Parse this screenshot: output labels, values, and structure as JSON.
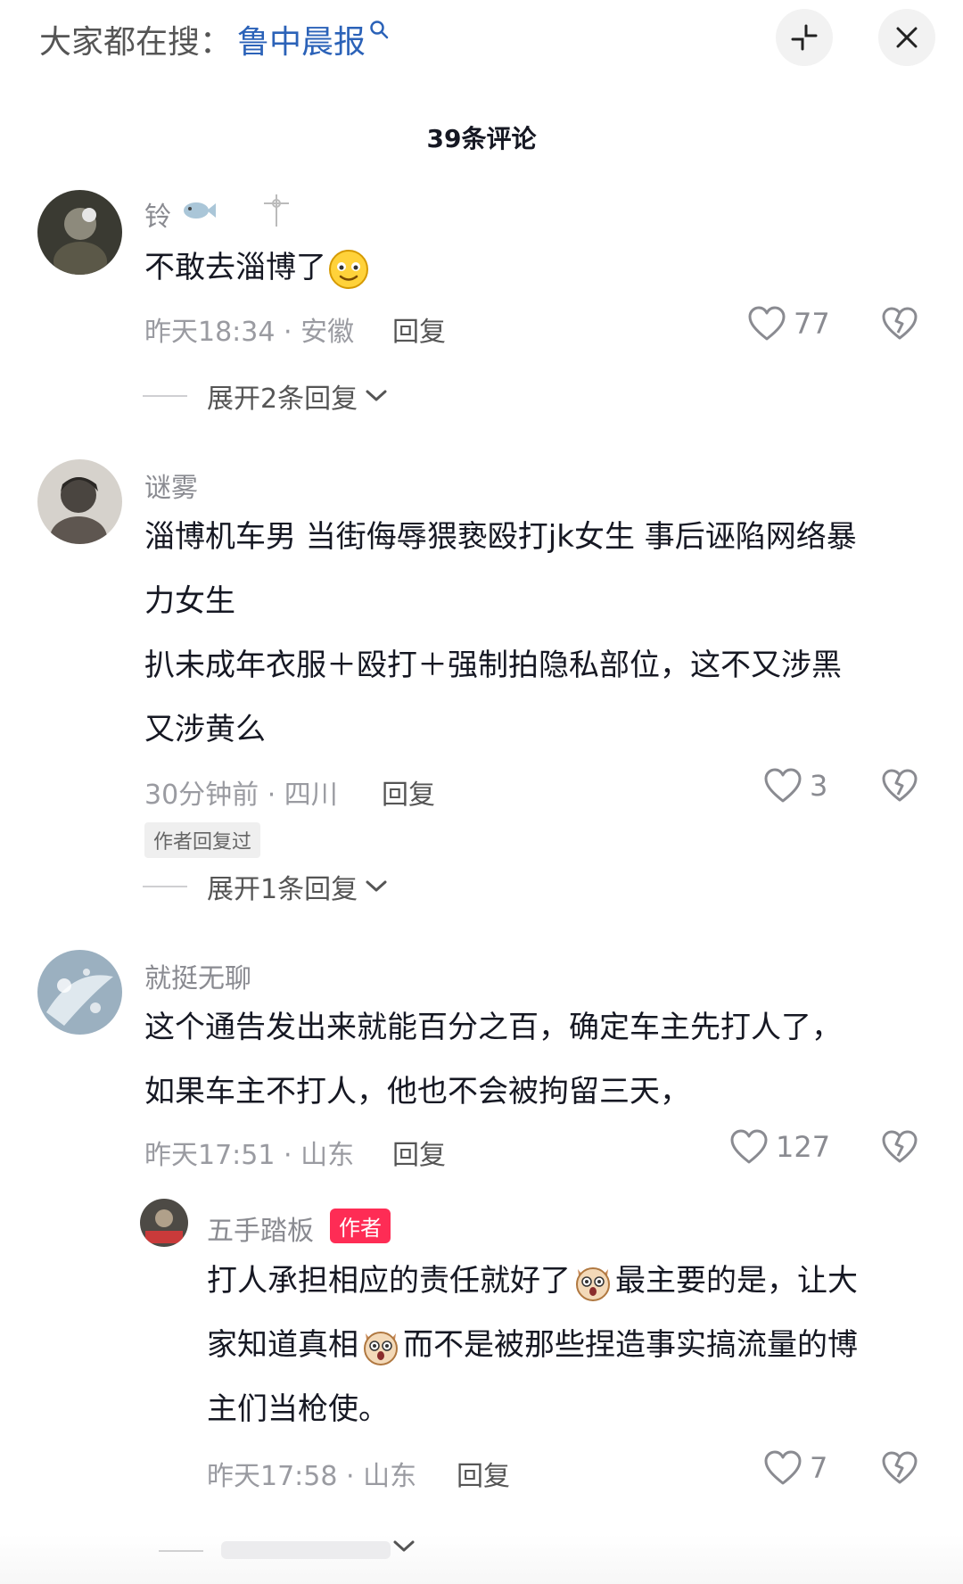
{
  "header": {
    "search_prefix": "大家都在搜：",
    "search_term": "鲁中晨报",
    "comment_count": "39条评论"
  },
  "comments": [
    {
      "username": "铃",
      "text": "不敢去淄博了",
      "time_location": "昨天18:34 · 安徽",
      "reply_label": "回复",
      "likes": "77",
      "expand_label": "展开2条回复"
    },
    {
      "username": "谜雾",
      "text_lines": [
        "淄博机车男 当街侮辱猥亵殴打jk女生 事后诬陷网络暴",
        "力女生",
        "扒未成年衣服＋殴打＋强制拍隐私部位，这不又涉黑",
        "又涉黄么"
      ],
      "time_location": "30分钟前 · 四川",
      "reply_label": "回复",
      "likes": "3",
      "author_replied": "作者回复过",
      "expand_label": "展开1条回复"
    },
    {
      "username": "就挺无聊",
      "text_lines": [
        "这个通告发出来就能百分之百，确定车主先打人了，",
        "如果车主不打人，他也不会被拘留三天，"
      ],
      "time_location": "昨天17:51 · 山东",
      "reply_label": "回复",
      "likes": "127"
    }
  ],
  "reply": {
    "username": "五手踏板",
    "author_badge": "作者",
    "line1_a": "打人承担相应的责任就好了",
    "line1_b": "最主要的是，让大",
    "line2_a": "家知道真相",
    "line2_b": "而不是被那些捏造事实搞流量的博",
    "line3": "主们当枪使。",
    "time_location": "昨天17:58 · 山东",
    "reply_label": "回复",
    "likes": "7"
  },
  "colors": {
    "accent_link": "#2b62b8",
    "author_badge": "#fe2c55",
    "meta_gray": "#9a9ba1"
  },
  "icons": [
    "search-icon",
    "shrink-icon",
    "close-icon",
    "heart-icon",
    "dislike-heart-icon",
    "chevron-down-icon",
    "fish-icon",
    "cross-icon",
    "smile-emoji",
    "dog-emoji"
  ]
}
